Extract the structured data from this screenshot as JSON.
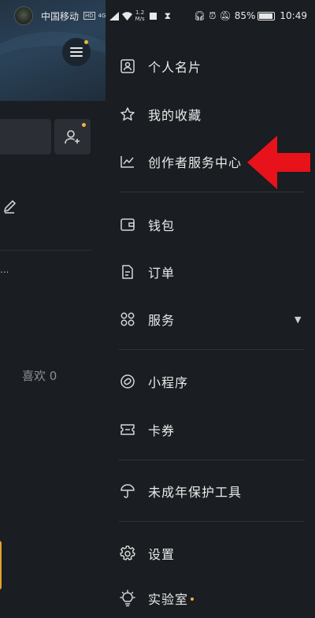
{
  "status_bar": {
    "carrier": "中国移动",
    "hd": "HD",
    "network": "4G",
    "speed_value": "1.2",
    "speed_unit": "M/s",
    "battery": "85%",
    "time": "10:49"
  },
  "background_page": {
    "likes_label": "喜欢 0",
    "ellipsis": "..."
  },
  "drawer": {
    "items": [
      {
        "label": "个人名片",
        "icon": "id-card-icon"
      },
      {
        "label": "我的收藏",
        "icon": "star-icon"
      },
      {
        "label": "创作者服务中心",
        "icon": "line-chart-icon"
      },
      {
        "label": "钱包",
        "icon": "wallet-icon"
      },
      {
        "label": "订单",
        "icon": "order-document-icon"
      },
      {
        "label": "服务",
        "icon": "grid-services-icon"
      },
      {
        "label": "小程序",
        "icon": "mini-program-link-icon"
      },
      {
        "label": "卡券",
        "icon": "coupon-ticket-icon"
      },
      {
        "label": "未成年保护工具",
        "icon": "umbrella-icon"
      },
      {
        "label": "设置",
        "icon": "gear-icon"
      },
      {
        "label": "实验室",
        "icon": "lightbulb-icon"
      }
    ]
  },
  "colors": {
    "accent_dot": "#f0b43c",
    "annotation_arrow": "#e8121b",
    "drawer_bg": "#1a1d21"
  }
}
